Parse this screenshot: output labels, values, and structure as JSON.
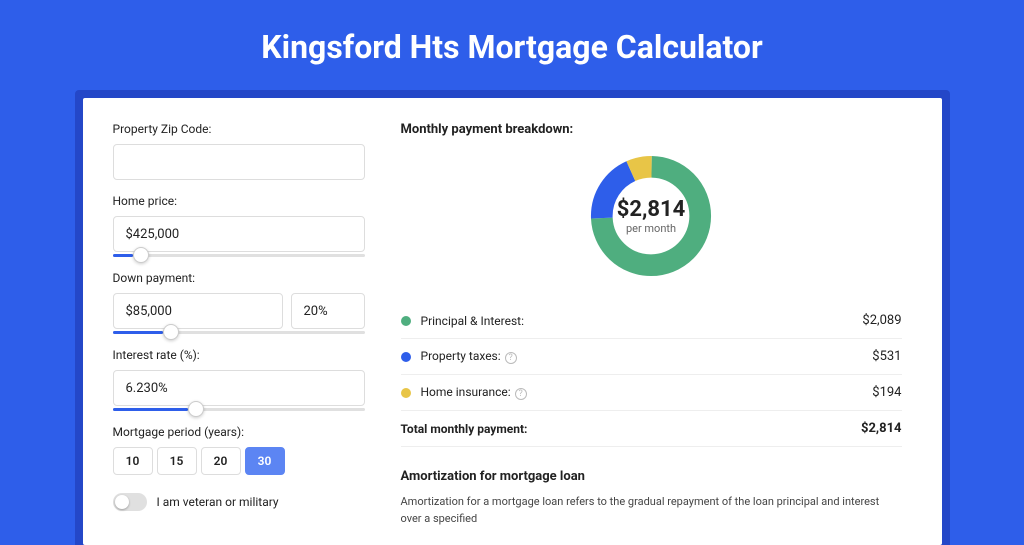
{
  "title": "Kingsford Hts Mortgage Calculator",
  "form": {
    "zip": {
      "label": "Property Zip Code:",
      "value": ""
    },
    "price": {
      "label": "Home price:",
      "value": "$425,000",
      "slider_pct": 8
    },
    "down": {
      "label": "Down payment:",
      "value": "$85,000",
      "pct": "20%",
      "slider_pct": 20
    },
    "rate": {
      "label": "Interest rate (%):",
      "value": "6.230%",
      "slider_pct": 30
    },
    "period": {
      "label": "Mortgage period (years):",
      "options": [
        "10",
        "15",
        "20",
        "30"
      ],
      "active": "30"
    },
    "veteran": {
      "label": "I am veteran or military",
      "on": false
    }
  },
  "breakdown": {
    "title": "Monthly payment breakdown:",
    "center_amount": "$2,814",
    "center_sub": "per month",
    "items": [
      {
        "color": "green",
        "label": "Principal & Interest:",
        "info": false,
        "value": "$2,089"
      },
      {
        "color": "blue",
        "label": "Property taxes:",
        "info": true,
        "value": "$531"
      },
      {
        "color": "yellow",
        "label": "Home insurance:",
        "info": true,
        "value": "$194"
      }
    ],
    "total": {
      "label": "Total monthly payment:",
      "value": "$2,814"
    }
  },
  "chart_data": {
    "type": "pie",
    "title": "Monthly payment breakdown",
    "series": [
      {
        "name": "Principal & Interest",
        "value": 2089,
        "color": "#4fae7f"
      },
      {
        "name": "Property taxes",
        "value": 531,
        "color": "#2e5eea"
      },
      {
        "name": "Home insurance",
        "value": 194,
        "color": "#e8c547"
      }
    ],
    "total": 2814,
    "center_label": "$2,814 per month"
  },
  "amort": {
    "title": "Amortization for mortgage loan",
    "text": "Amortization for a mortgage loan refers to the gradual repayment of the loan principal and interest over a specified"
  }
}
